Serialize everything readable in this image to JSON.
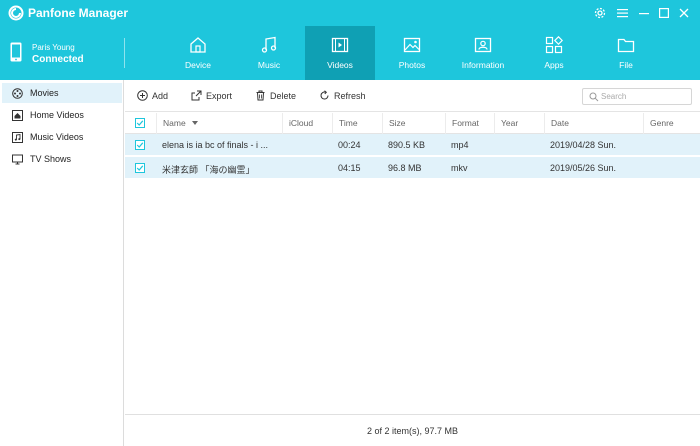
{
  "app": {
    "title": "Panfone Manager",
    "accent_color": "#1ec6dc",
    "active_tab_color": "#0fa0b4",
    "selection_color": "#e1f2fa"
  },
  "window_controls": [
    {
      "name": "settings-icon"
    },
    {
      "name": "menu-icon"
    },
    {
      "name": "minimize-icon"
    },
    {
      "name": "maximize-icon"
    },
    {
      "name": "close-icon"
    }
  ],
  "device": {
    "name": "Paris Young",
    "status": "Connected"
  },
  "tabs": [
    {
      "label": "Device",
      "icon": "home-icon"
    },
    {
      "label": "Music",
      "icon": "music-note-icon"
    },
    {
      "label": "Videos",
      "icon": "film-icon",
      "active": true
    },
    {
      "label": "Photos",
      "icon": "image-icon"
    },
    {
      "label": "Information",
      "icon": "contact-card-icon"
    },
    {
      "label": "Apps",
      "icon": "apps-grid-icon"
    },
    {
      "label": "File",
      "icon": "folder-icon"
    }
  ],
  "sidebar": {
    "items": [
      {
        "label": "Movies",
        "icon": "film-reel-icon",
        "active": true
      },
      {
        "label": "Home Videos",
        "icon": "house-icon"
      },
      {
        "label": "Music Videos",
        "icon": "music-video-icon"
      },
      {
        "label": "TV Shows",
        "icon": "tv-icon"
      }
    ]
  },
  "toolbar": {
    "add": "Add",
    "export": "Export",
    "delete": "Delete",
    "refresh": "Refresh",
    "search_placeholder": "Search"
  },
  "table": {
    "columns": [
      "Name",
      "iCloud",
      "Time",
      "Size",
      "Format",
      "Year",
      "Date",
      "Genre"
    ],
    "rows": [
      {
        "name": "elena is ia bc of finals - i ...",
        "icloud": "",
        "time": "00:24",
        "size": "890.5 KB",
        "format": "mp4",
        "year": "",
        "date": "2019/04/28 Sun.",
        "genre": "",
        "checked": true
      },
      {
        "name": "米津玄師 「海の幽霊」",
        "icloud": "",
        "time": "04:15",
        "size": "96.8 MB",
        "format": "mkv",
        "year": "",
        "date": "2019/05/26 Sun.",
        "genre": "",
        "checked": true
      }
    ]
  },
  "status": {
    "text": "2 of 2 item(s), 97.7 MB"
  }
}
